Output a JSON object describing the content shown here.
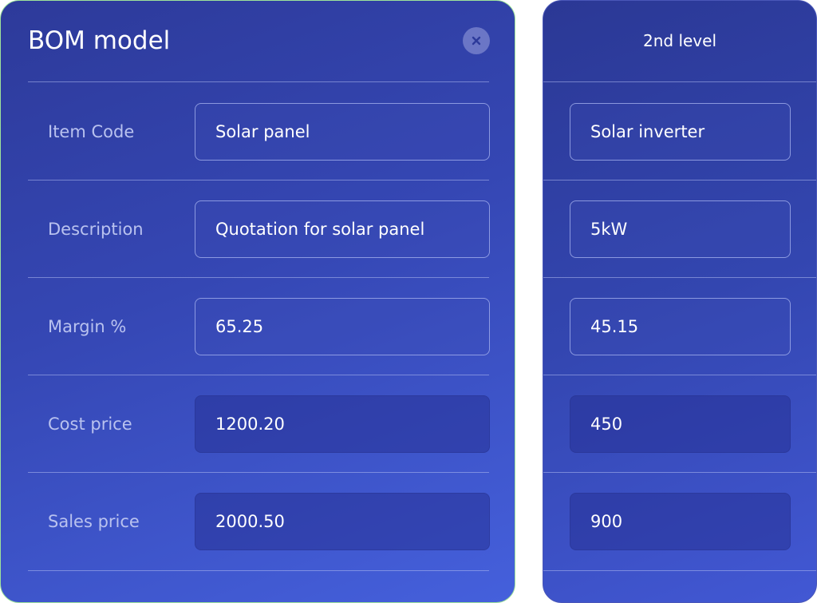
{
  "dialog": {
    "title": "BOM model",
    "close_icon": "close-icon"
  },
  "second_level": {
    "title": "2nd level"
  },
  "rows": [
    {
      "label": "Item Code",
      "value": "Solar panel",
      "second_value": "Solar inverter",
      "editable": true
    },
    {
      "label": "Description",
      "value": "Quotation for solar panel",
      "second_value": "5kW",
      "editable": true
    },
    {
      "label": "Margin %",
      "value": "65.25",
      "second_value": "45.15",
      "editable": true
    },
    {
      "label": "Cost price",
      "value": "1200.20",
      "second_value": "450",
      "editable": false
    },
    {
      "label": "Sales price",
      "value": "2000.50",
      "second_value": "900",
      "editable": false
    }
  ],
  "colors": {
    "card_gradient_start": "#2d3a9a",
    "card_gradient_end": "#4560dc",
    "label_text": "#b9c2ef",
    "value_text": "#ffffff",
    "card_border": "#9ee39a"
  }
}
